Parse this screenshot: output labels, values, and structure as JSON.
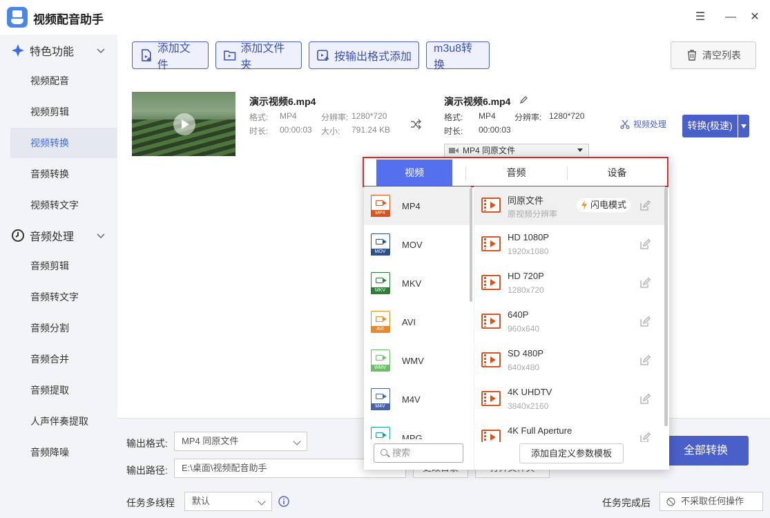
{
  "app": {
    "title": "视频配音助手"
  },
  "window": {
    "menu": "☰",
    "minimize": "—",
    "close": "✕"
  },
  "sidebar": {
    "sections": [
      {
        "label": "特色功能",
        "items": [
          "视频配音",
          "视频剪辑",
          "视频转换",
          "音频转换",
          "视频转文字"
        ],
        "active": "视频转换"
      },
      {
        "label": "音频处理",
        "items": [
          "音频剪辑",
          "音频转文字",
          "音频分割",
          "音频合并",
          "音频提取",
          "人声伴奏提取",
          "音频降噪"
        ]
      }
    ]
  },
  "toolbar": {
    "add_file": "添加文件",
    "add_folder": "添加文件夹",
    "add_by_format": "按输出格式添加",
    "m3u8": "m3u8转换",
    "clear_list": "清空列表"
  },
  "file": {
    "source": {
      "name": "演示视频6.mp4",
      "format_label": "格式:",
      "format": "MP4",
      "resolution_label": "分辨率:",
      "resolution": "1280*720",
      "duration_label": "时长:",
      "duration": "00:00:03",
      "size_label": "大小:",
      "size": "791.24 KB"
    },
    "output": {
      "name": "演示视频6.mp4",
      "format_label": "格式:",
      "format": "MP4",
      "resolution_label": "分辨率:",
      "resolution": "1280*720",
      "duration_label": "时长:",
      "duration": "00:00:03",
      "format_select": "MP4  同原文件"
    },
    "video_process": "视频处理",
    "convert": "转换(极速)"
  },
  "popup": {
    "tabs": [
      "视频",
      "音频",
      "设备"
    ],
    "active_tab": "视频",
    "formats": [
      {
        "label": "MP4",
        "color": "#d9541e"
      },
      {
        "label": "MOV",
        "color": "#2d4f8c"
      },
      {
        "label": "MKV",
        "color": "#2e7d3a"
      },
      {
        "label": "AVI",
        "color": "#e88a2c"
      },
      {
        "label": "WMV",
        "color": "#6fbf6a"
      },
      {
        "label": "M4V",
        "color": "#4a63a8"
      },
      {
        "label": "MPG",
        "color": "#1aa39a"
      }
    ],
    "presets": [
      {
        "name": "同原文件",
        "sub": "原视频分辨率"
      },
      {
        "name": "HD 1080P",
        "sub": "1920x1080"
      },
      {
        "name": "HD 720P",
        "sub": "1280x720"
      },
      {
        "name": "640P",
        "sub": "960x640"
      },
      {
        "name": "SD 480P",
        "sub": "640x480"
      },
      {
        "name": "4K UHDTV",
        "sub": "3840x2160"
      },
      {
        "name": "4K Full Aperture",
        "sub": ""
      }
    ],
    "flash_mode": "闪电模式",
    "search_placeholder": "搜索",
    "add_template": "添加自定义参数模板"
  },
  "bottom": {
    "output_format_label": "输出格式:",
    "output_format_value": "MP4  同原文件",
    "output_path_label": "输出路径:",
    "output_path_value": "E:\\桌面\\视频配音助手",
    "change_dir": "更改目录",
    "open_dir": "打开文件夹",
    "threads_label": "任务多线程",
    "threads_value": "默认",
    "after_done_label": "任务完成后",
    "after_done_value": "不采取任何操作",
    "convert_all": "全部转换"
  }
}
